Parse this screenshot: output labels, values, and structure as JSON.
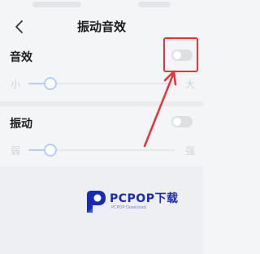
{
  "header": {
    "title": "振动音效"
  },
  "sound_effects": {
    "label": "音效",
    "toggle_on": false,
    "slider": {
      "min_label": "小",
      "max_label": "大",
      "level": 0.15
    }
  },
  "vibration": {
    "label": "振动",
    "toggle_on": false,
    "slider": {
      "min_label": "弱",
      "max_label": "强",
      "level": 0.15
    }
  },
  "watermark": {
    "brand": "PCPOP下载",
    "sub": "PCPOP Download"
  },
  "colors": {
    "annotation": "#e0353a",
    "accent": "#b6cdf7",
    "brand": "#1a2ab8"
  },
  "icons": {
    "back": "chevron-left-icon",
    "logo": "pcpop-logo-icon"
  }
}
